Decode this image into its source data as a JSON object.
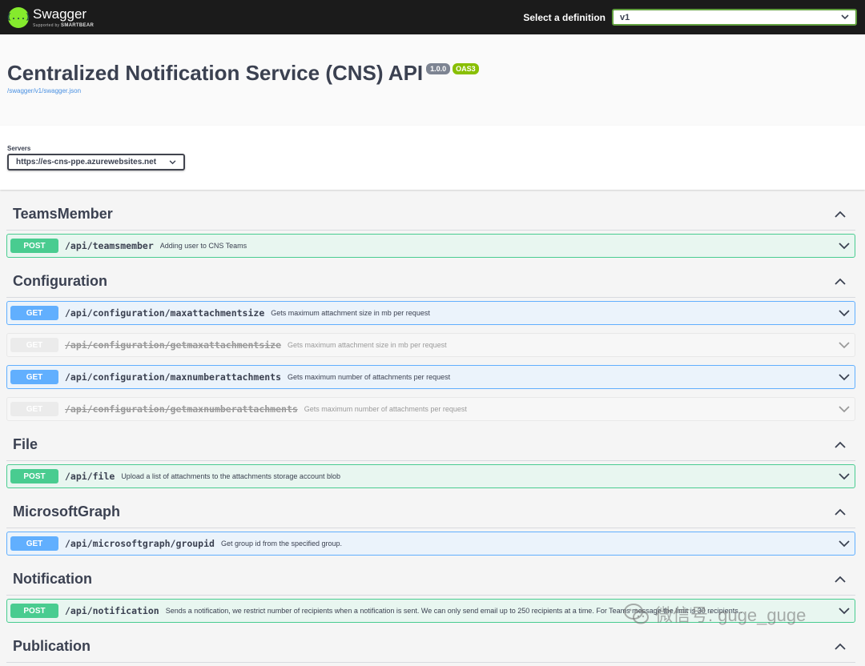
{
  "header": {
    "logo_mark": "{...}",
    "logo_name": "Swagger",
    "logo_sub_prefix": "Supported by",
    "logo_sub_brand": "SMARTBEAR",
    "definition_label": "Select a definition",
    "definition_value": "v1"
  },
  "info": {
    "title": "Centralized Notification Service (CNS) API",
    "version": "1.0.0",
    "oas": "OAS3",
    "spec_url": "/swagger/v1/swagger.json"
  },
  "servers": {
    "label": "Servers",
    "selected": "https://es-cns-ppe.azurewebsites.net"
  },
  "tags": [
    {
      "name": "TeamsMember",
      "operations": [
        {
          "method": "POST",
          "path": "/api/teamsmember",
          "summary": "Adding user to CNS Teams"
        }
      ]
    },
    {
      "name": "Configuration",
      "operations": [
        {
          "method": "GET",
          "path": "/api/configuration/maxattachmentsize",
          "summary": "Gets maximum attachment size in mb per request"
        },
        {
          "method": "GET",
          "path": "/api/configuration/getmaxattachmentsize",
          "summary": "Gets maximum attachment size in mb per request",
          "deprecated": true
        },
        {
          "method": "GET",
          "path": "/api/configuration/maxnumberattachments",
          "summary": "Gets maximum number of attachments per request"
        },
        {
          "method": "GET",
          "path": "/api/configuration/getmaxnumberattachments",
          "summary": "Gets maximum number of attachments per request",
          "deprecated": true
        }
      ]
    },
    {
      "name": "File",
      "operations": [
        {
          "method": "POST",
          "path": "/api/file",
          "summary": "Upload a list of attachments to the attachments storage account blob"
        }
      ]
    },
    {
      "name": "MicrosoftGraph",
      "operations": [
        {
          "method": "GET",
          "path": "/api/microsoftgraph/groupid",
          "summary": "Get group id from the specified group."
        }
      ]
    },
    {
      "name": "Notification",
      "operations": [
        {
          "method": "POST",
          "path": "/api/notification",
          "summary": "Sends a notification, we restrict number of recipients when a notification is sent. We can only send email up to 250 recipients at a time. For Teams message the limit is 30 recipients.."
        }
      ]
    },
    {
      "name": "Publication",
      "operations": []
    }
  ],
  "watermark": {
    "text": "微信号: guge_guge"
  },
  "colors": {
    "post": "#49cc90",
    "get": "#61affe",
    "topbar": "#1b1b1b",
    "logo": "#85ea2d",
    "oas_badge": "#89bf04",
    "version_badge": "#7d8492"
  }
}
